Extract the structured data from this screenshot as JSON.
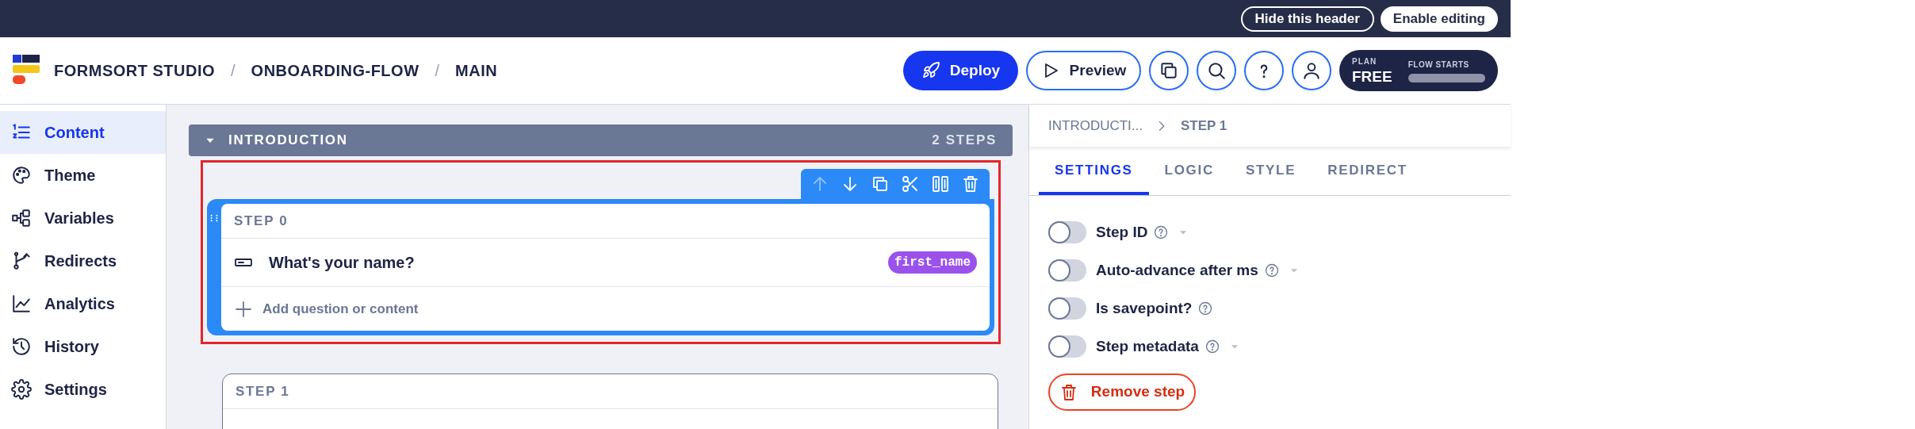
{
  "top_bar": {
    "buttons": [
      "Hide this header",
      "Enable editing"
    ]
  },
  "header": {
    "breadcrumb": [
      "FORMSORT STUDIO",
      "ONBOARDING-FLOW",
      "MAIN"
    ],
    "separator": "/",
    "deploy": "Deploy",
    "preview": "Preview",
    "plan": {
      "label": "PLAN",
      "value": "FREE"
    },
    "flow_starts": {
      "label": "FLOW STARTS",
      "level": 0
    }
  },
  "sidebar": {
    "items": [
      {
        "label": "Content",
        "selected": true
      },
      {
        "label": "Theme",
        "selected": false
      },
      {
        "label": "Variables",
        "selected": false
      },
      {
        "label": "Redirects",
        "selected": false
      },
      {
        "label": "Analytics",
        "selected": false
      },
      {
        "label": "History",
        "selected": false
      },
      {
        "label": "Settings",
        "selected": false
      }
    ]
  },
  "group": {
    "title": "INTRODUCTION",
    "count": "2 STEPS",
    "expanded": true
  },
  "steps": [
    {
      "title": "STEP 0",
      "selected": true,
      "questions": [
        {
          "label": "What's your name?",
          "variable": "first_name"
        }
      ],
      "add_label": "Add question or content"
    },
    {
      "title": "STEP 1",
      "selected": false
    }
  ],
  "panel": {
    "breadcrumb": [
      "INTRODUCTI...",
      "STEP 1"
    ],
    "tabs": [
      {
        "label": "SETTINGS",
        "selected": true
      },
      {
        "label": "LOGIC",
        "selected": false
      },
      {
        "label": "STYLE",
        "selected": false
      },
      {
        "label": "REDIRECT",
        "selected": false
      }
    ],
    "settings": [
      {
        "label": "Step ID",
        "on": false,
        "has_dropdown": true
      },
      {
        "label": "Auto-advance after ms",
        "on": false,
        "has_dropdown": true
      },
      {
        "label": "Is savepoint?",
        "on": false,
        "has_dropdown": false
      },
      {
        "label": "Step metadata",
        "on": false,
        "has_dropdown": true
      }
    ],
    "remove": "Remove step"
  }
}
